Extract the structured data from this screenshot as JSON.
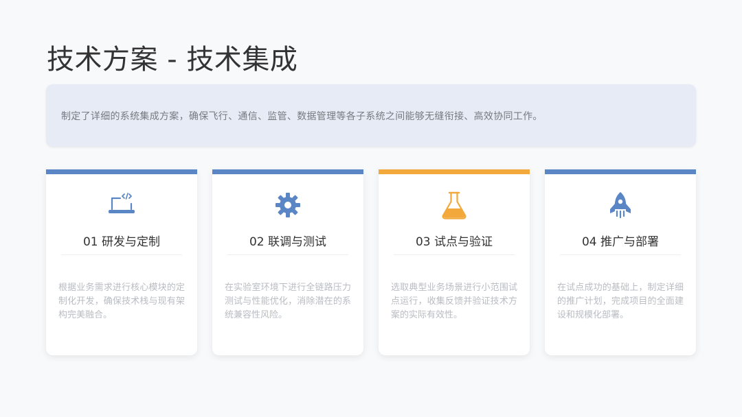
{
  "slide": {
    "title": "技术方案 - 技术集成",
    "summary": "制定了详细的系统集成方案，确保飞行、通信、监管、数据管理等各子系统之间能够无缝衔接、高效协同工作。"
  },
  "colors": {
    "primary_blue": "#5b86c5",
    "accent_orange": "#f2a83a",
    "title_text": "#333333",
    "summary_bg": "#e6ebf5"
  },
  "cards": [
    {
      "icon": "laptop-code-icon",
      "accent": "#5b86c5",
      "title": "01 研发与定制",
      "desc": "根据业务需求进行核心模块的定制化开发，确保技术栈与现有架构完美融合。"
    },
    {
      "icon": "gear-icon",
      "accent": "#5b86c5",
      "title": "02 联调与测试",
      "desc": "在实验室环境下进行全链路压力测试与性能优化，消除潜在的系统兼容性风险。"
    },
    {
      "icon": "flask-icon",
      "accent": "#f2a83a",
      "title": "03 试点与验证",
      "desc": "选取典型业务场景进行小范围试点运行，收集反馈并验证技术方案的实际有效性。"
    },
    {
      "icon": "rocket-icon",
      "accent": "#5b86c5",
      "title": "04 推广与部署",
      "desc": "在试点成功的基础上，制定详细的推广计划，完成项目的全面建设和规模化部署。"
    }
  ]
}
